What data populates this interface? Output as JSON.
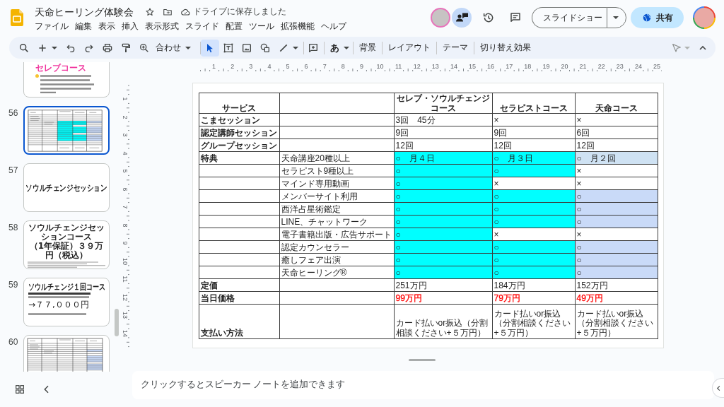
{
  "header": {
    "title": "天命ヒーリング体験会",
    "save_status": "ドライブに保存しました",
    "menu": [
      "ファイル",
      "編集",
      "表示",
      "挿入",
      "表示形式",
      "スライド",
      "配置",
      "ツール",
      "拡張機能",
      "ヘルプ"
    ],
    "slideshow_button": "スライドショー",
    "share_button": "共有"
  },
  "toolbar": {
    "zoom": "合わせ",
    "tools": [
      {
        "kind": "select",
        "selected": true
      },
      {
        "kind": "textbox",
        "selected": false
      },
      {
        "kind": "image",
        "selected": false
      },
      {
        "kind": "shape",
        "selected": false
      },
      {
        "kind": "line",
        "selected": false
      }
    ],
    "input_tool": "あ",
    "buttons": [
      "背景",
      "レイアウト",
      "テーマ",
      "切り替え効果"
    ]
  },
  "filmstrip": {
    "slides": [
      {
        "kind": "text",
        "selected": false,
        "heading": "セレブコース"
      },
      {
        "number": "56",
        "kind": "table_colored",
        "selected": true
      },
      {
        "number": "57",
        "kind": "title",
        "selected": false,
        "title_lines": [
          "ソウルチェンジセッション"
        ]
      },
      {
        "number": "58",
        "kind": "title_notes",
        "selected": false,
        "title_lines": [
          "ソウルチェンジセッションコース",
          "（1年保証）３９万円（税込）"
        ]
      },
      {
        "number": "59",
        "kind": "offer",
        "selected": false,
        "title": "ソウルチェンジ１回コース",
        "price": "→７７,０００円"
      },
      {
        "number": "60",
        "kind": "table",
        "selected": false
      }
    ]
  },
  "rulers": {
    "horizontal": [
      "1",
      "2",
      "3",
      "4",
      "5",
      "6",
      "7",
      "8",
      "9",
      "10",
      "11",
      "12",
      "13",
      "14",
      "15",
      "16",
      "17",
      "18",
      "19",
      "20",
      "21",
      "22",
      "23",
      "24",
      "25"
    ],
    "vertical": [
      "1",
      "2",
      "3",
      "4",
      "5",
      "6",
      "7",
      "8",
      "9",
      "10",
      "11",
      "12",
      "13",
      "14"
    ]
  },
  "slide": {
    "table": {
      "service_header": "サービス",
      "courses": [
        "セレブ・ソウルチェンジコース",
        "セラピストコース",
        "天命コース"
      ],
      "rows": [
        {
          "kind": "count",
          "service": "こまセッション",
          "cells": [
            {
              "text": "3回　45分"
            },
            {
              "text": "×"
            },
            {
              "text": "×"
            }
          ]
        },
        {
          "kind": "count",
          "service": "認定講師セッション",
          "cells": [
            {
              "text": "9回"
            },
            {
              "text": "9回"
            },
            {
              "text": "6回"
            }
          ]
        },
        {
          "kind": "count",
          "service": "グループセッション",
          "cells": [
            {
              "text": "12回"
            },
            {
              "text": "12回"
            },
            {
              "text": "12回"
            }
          ]
        },
        {
          "kind": "perk",
          "service": "特典",
          "item": "天命講座20種以上",
          "cells": [
            {
              "text": "○　月４日",
              "color": "#00ffff"
            },
            {
              "text": "○　月３日",
              "color": "#00ffff"
            },
            {
              "text": "○　月２回",
              "color": "#cfe2f3"
            }
          ]
        },
        {
          "kind": "perk",
          "item": "セラピスト9種以上",
          "cells": [
            {
              "text": "○",
              "color": "#00ffff"
            },
            {
              "text": "○",
              "color": "#00ffff"
            },
            {
              "text": "×"
            }
          ]
        },
        {
          "kind": "perk",
          "item": "マインド専用動画",
          "cells": [
            {
              "text": "○",
              "color": "#00ffff"
            },
            {
              "text": "×"
            },
            {
              "text": "×"
            }
          ]
        },
        {
          "kind": "perk",
          "item": "メンバーサイト利用",
          "cells": [
            {
              "text": "○",
              "color": "#00ffff"
            },
            {
              "text": "○",
              "color": "#00ffff"
            },
            {
              "text": "○",
              "color": "#c9daf8"
            }
          ]
        },
        {
          "kind": "perk",
          "item": "西洋占星術鑑定",
          "cells": [
            {
              "text": "○",
              "color": "#00ffff"
            },
            {
              "text": "○",
              "color": "#00ffff"
            },
            {
              "text": "○",
              "color": "#c9daf8"
            }
          ]
        },
        {
          "kind": "perk",
          "item": "LINE、チャットワーク",
          "cells": [
            {
              "text": "○",
              "color": "#00ffff"
            },
            {
              "text": "○",
              "color": "#00ffff"
            },
            {
              "text": "○",
              "color": "#c9daf8"
            }
          ]
        },
        {
          "kind": "perk",
          "item": "電子書籍出版・広告サポート",
          "cells": [
            {
              "text": "○",
              "color": "#00ffff"
            },
            {
              "text": "×"
            },
            {
              "text": "×"
            }
          ]
        },
        {
          "kind": "perk",
          "item": "認定カウンセラー",
          "cells": [
            {
              "text": "○",
              "color": "#00ffff"
            },
            {
              "text": "○",
              "color": "#00ffff"
            },
            {
              "text": "○",
              "color": "#c9daf8"
            }
          ]
        },
        {
          "kind": "perk",
          "item": "癒しフェア出演",
          "cells": [
            {
              "text": "○",
              "color": "#00ffff"
            },
            {
              "text": "○",
              "color": "#00ffff"
            },
            {
              "text": "○",
              "color": "#c9daf8"
            }
          ]
        },
        {
          "kind": "perk",
          "item": "天命ヒーリング®",
          "cells": [
            {
              "text": "○",
              "color": "#00ffff"
            },
            {
              "text": "○",
              "color": "#00ffff"
            },
            {
              "text": "○",
              "color": "#c9daf8"
            }
          ]
        },
        {
          "kind": "price",
          "service": "定価",
          "cells": [
            {
              "text": "251万円"
            },
            {
              "text": "184万円"
            },
            {
              "text": "152万円"
            }
          ]
        },
        {
          "kind": "sale",
          "service": "当日価格",
          "cells": [
            {
              "text": "99万円",
              "color": "#ff0000"
            },
            {
              "text": "79万円",
              "color": "#ff0000"
            },
            {
              "text": "49万円",
              "color": "#ff0000"
            }
          ]
        },
        {
          "kind": "payment",
          "service": "支払い方法",
          "cells": [
            {
              "text": "カード払いor振込（分割相談ください+５万円）"
            },
            {
              "text": "カード払いor振込（分割相談ください+５万円）"
            },
            {
              "text": "カード払いor振込（分割相談ください+５万円）"
            }
          ]
        }
      ]
    }
  },
  "speaker_notes": {
    "placeholder": "クリックするとスピーカー ノートを追加できます"
  }
}
